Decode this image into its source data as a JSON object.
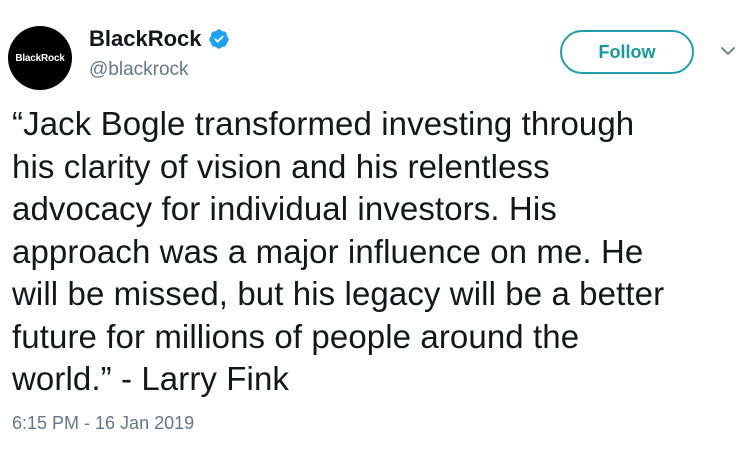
{
  "account": {
    "display_name": "BlackRock",
    "handle": "@blackrock",
    "avatar_text": "BlackRock",
    "verified_icon": "verified-badge-icon"
  },
  "actions": {
    "follow_label": "Follow",
    "more_icon": "chevron-down-icon"
  },
  "tweet": {
    "text": "“Jack Bogle transformed investing through\nhis clarity of vision and his relentless\nadvocacy for individual investors. His\napproach was a major influence on me. He\nwill be missed, but his legacy will be a better\nfuture for millions of people around the\nworld.” - Larry Fink",
    "timestamp": "6:15 PM - 16 Jan 2019"
  },
  "colors": {
    "accent": "#1ea0a8",
    "verified": "#1da1f2",
    "text": "#14171a",
    "muted": "#657786"
  }
}
